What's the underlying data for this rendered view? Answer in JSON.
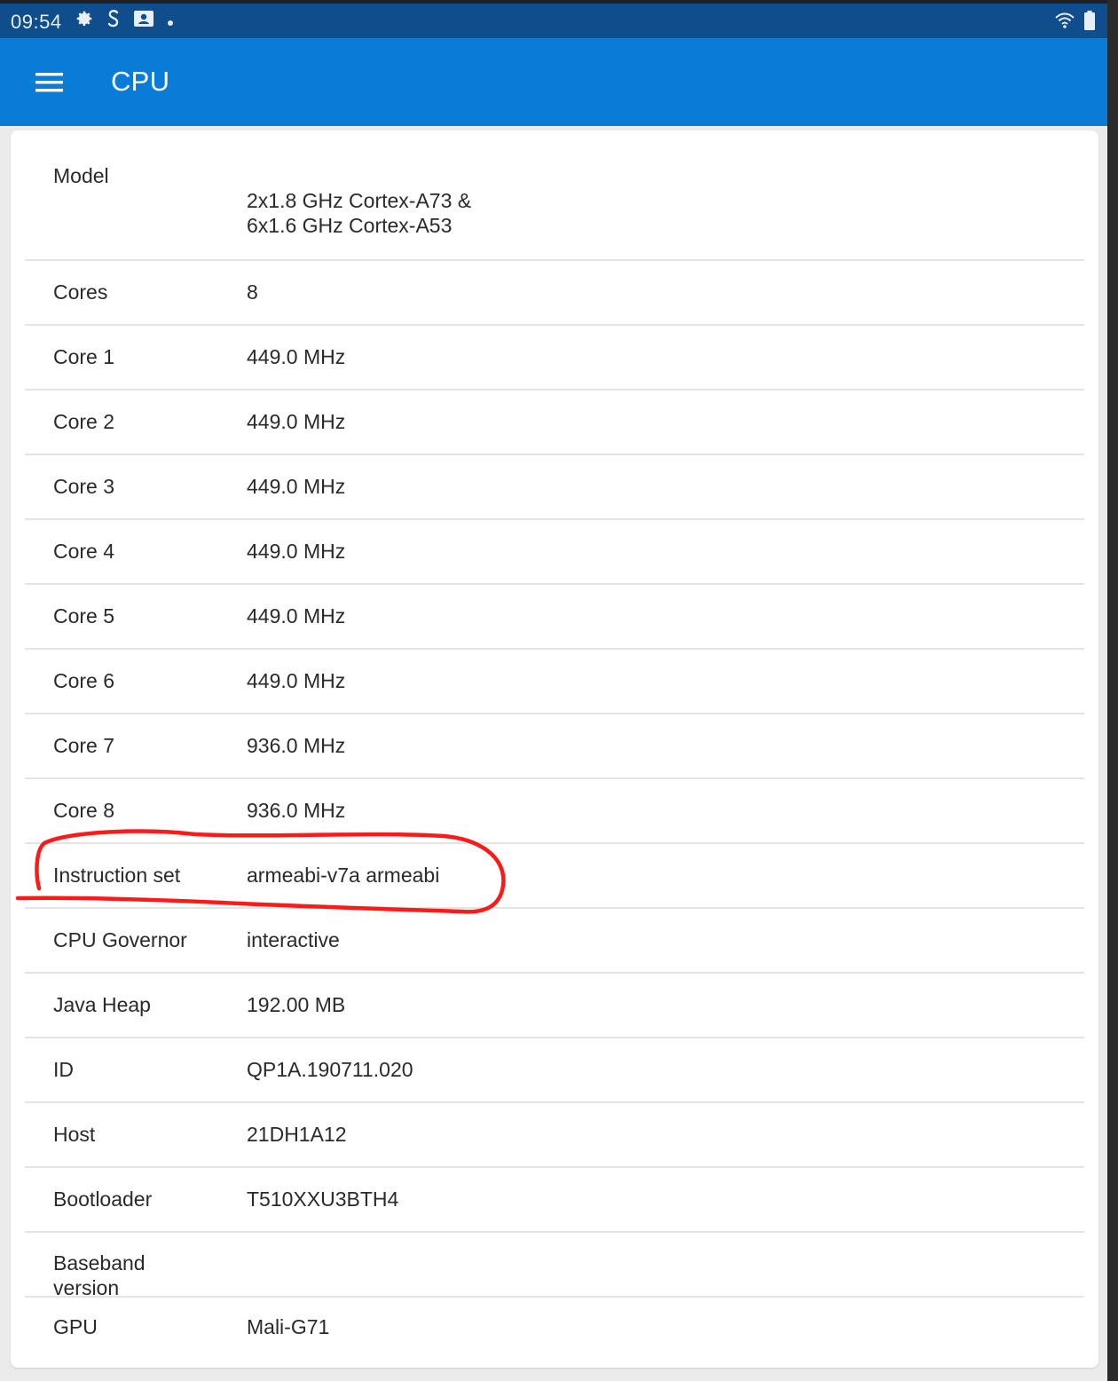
{
  "status_bar": {
    "time": "09:54"
  },
  "app_bar": {
    "title": "CPU"
  },
  "rows": [
    {
      "label": "Model",
      "value": "2x1.8 GHz Cortex-A73 &\n6x1.6 GHz Cortex-A53"
    },
    {
      "label": "Cores",
      "value": "8"
    },
    {
      "label": "Core 1",
      "value": "449.0 MHz"
    },
    {
      "label": "Core 2",
      "value": "449.0 MHz"
    },
    {
      "label": "Core 3",
      "value": "449.0 MHz"
    },
    {
      "label": "Core 4",
      "value": "449.0 MHz"
    },
    {
      "label": "Core 5",
      "value": "449.0 MHz"
    },
    {
      "label": "Core 6",
      "value": "449.0 MHz"
    },
    {
      "label": "Core 7",
      "value": "936.0 MHz"
    },
    {
      "label": "Core 8",
      "value": "936.0 MHz"
    },
    {
      "label": "Instruction set",
      "value": "armeabi-v7a armeabi"
    },
    {
      "label": "CPU Governor",
      "value": "interactive"
    },
    {
      "label": "Java Heap",
      "value": "192.00 MB"
    },
    {
      "label": "ID",
      "value": "QP1A.190711.020"
    },
    {
      "label": "Host",
      "value": "21DH1A12"
    },
    {
      "label": "Bootloader",
      "value": "T510XXU3BTH4"
    },
    {
      "label": "Baseband version",
      "value": ""
    },
    {
      "label": "GPU",
      "value": "Mali-G71"
    }
  ],
  "colors": {
    "status_bar": "#0f4d8c",
    "app_bar": "#0a7bd6",
    "annotation": "#ff1a1a"
  }
}
